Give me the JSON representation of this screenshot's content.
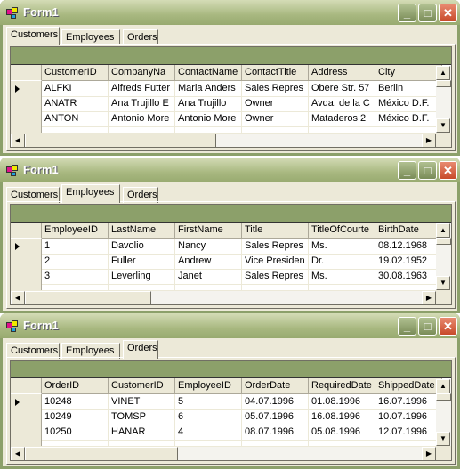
{
  "windows": [
    {
      "title": "Form1",
      "active_tab": 0,
      "tabs": [
        "Customers",
        "Employees",
        "Orders"
      ],
      "columns": [
        "CustomerID",
        "CompanyNa",
        "ContactName",
        "ContactTitle",
        "Address",
        "City"
      ],
      "rows": [
        [
          "ALFKI",
          "Alfreds Futter",
          "Maria Anders",
          "Sales Repres",
          "Obere Str. 57",
          "Berlin"
        ],
        [
          "ANATR",
          "Ana Trujillo E",
          "Ana Trujillo",
          "Owner",
          "Avda. de la C",
          "México D.F."
        ],
        [
          "ANTON",
          "Antonio More",
          "Antonio More",
          "Owner",
          "Mataderos  2",
          "México D.F."
        ]
      ],
      "hscroll_fraction": 0.5
    },
    {
      "title": "Form1",
      "active_tab": 1,
      "tabs": [
        "Customers",
        "Employees",
        "Orders"
      ],
      "columns": [
        "EmployeeID",
        "LastName",
        "FirstName",
        "Title",
        "TitleOfCourte",
        "BirthDate"
      ],
      "rows": [
        [
          "1",
          "Davolio",
          "Nancy",
          "Sales Repres",
          "Ms.",
          "08.12.1968"
        ],
        [
          "2",
          "Fuller",
          "Andrew",
          "Vice Presiden",
          "Dr.",
          "19.02.1952"
        ],
        [
          "3",
          "Leverling",
          "Janet",
          "Sales Repres",
          "Ms.",
          "30.08.1963"
        ]
      ],
      "hscroll_fraction": 0.33
    },
    {
      "title": "Form1",
      "active_tab": 2,
      "tabs": [
        "Customers",
        "Employees",
        "Orders"
      ],
      "columns": [
        "OrderID",
        "CustomerID",
        "EmployeeID",
        "OrderDate",
        "RequiredDate",
        "ShippedDate"
      ],
      "rows": [
        [
          "10248",
          "VINET",
          "5",
          "04.07.1996",
          "01.08.1996",
          "16.07.1996"
        ],
        [
          "10249",
          "TOMSP",
          "6",
          "05.07.1996",
          "16.08.1996",
          "10.07.1996"
        ],
        [
          "10250",
          "HANAR",
          "4",
          "08.07.1996",
          "05.08.1996",
          "12.07.1996"
        ]
      ],
      "hscroll_fraction": 0.4
    }
  ],
  "window_buttons": {
    "minimize": "_",
    "maximize": "□",
    "close": "✕"
  },
  "colors": {
    "caption": "#8ca06a",
    "face": "#ece9d8",
    "close": "#d85a3a"
  }
}
